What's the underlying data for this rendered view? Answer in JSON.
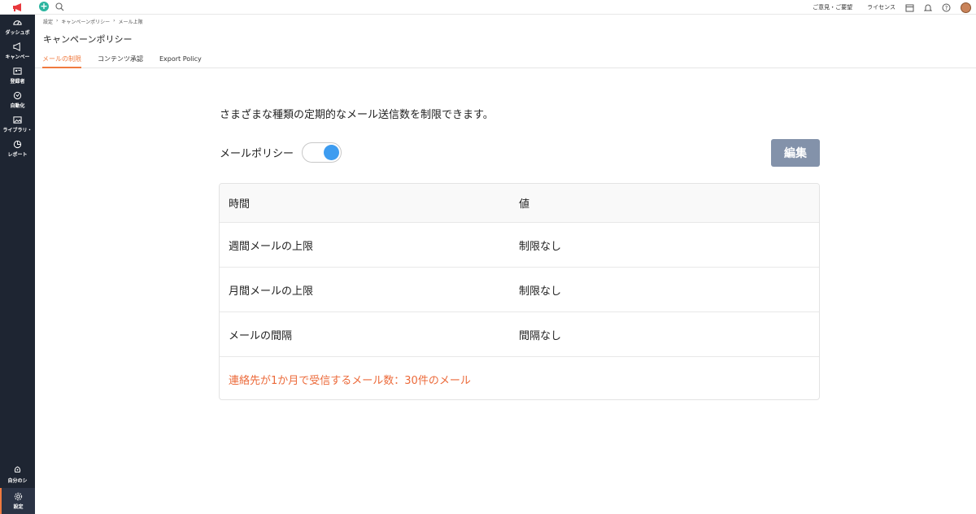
{
  "sidebar": {
    "items": [
      {
        "label": "ダッシュボ",
        "icon": "dashboard-icon"
      },
      {
        "label": "キャンペー",
        "icon": "megaphone-icon"
      },
      {
        "label": "登録者",
        "icon": "contacts-icon"
      },
      {
        "label": "自動化",
        "icon": "automation-icon"
      },
      {
        "label": "ライブラリ・",
        "icon": "library-icon"
      },
      {
        "label": "レポート",
        "icon": "reports-icon"
      }
    ],
    "bottom": [
      {
        "label": "自分のシ",
        "icon": "rocket-icon"
      },
      {
        "label": "設定",
        "icon": "gear-icon"
      }
    ]
  },
  "topbar": {
    "feedback": "ご意見・ご要望",
    "license": "ライセンス"
  },
  "breadcrumb": [
    "設定",
    "›",
    "キャンペーンポリシー",
    "›",
    "メール上限"
  ],
  "page_title": "キャンペーンポリシー",
  "tabs": [
    "メールの制限",
    "コンテンツ承認",
    "Export Policy"
  ],
  "description": "さまざまな種類の定期的なメール送信数を制限できます。",
  "policy": {
    "label": "メールポリシー",
    "enabled": true
  },
  "edit_label": "編集",
  "table": {
    "headers": [
      "時間",
      "値"
    ],
    "rows": [
      [
        "週間メールの上限",
        "制限なし"
      ],
      [
        "月間メールの上限",
        "制限なし"
      ],
      [
        "メールの間隔",
        "間隔なし"
      ]
    ],
    "note": "連絡先が1か月で受信するメール数：30件のメール"
  },
  "colors": {
    "accent": "#f07a3f",
    "toggle": "#3d9cf0",
    "button": "#8392aa",
    "sidebar": "#1e2532"
  }
}
